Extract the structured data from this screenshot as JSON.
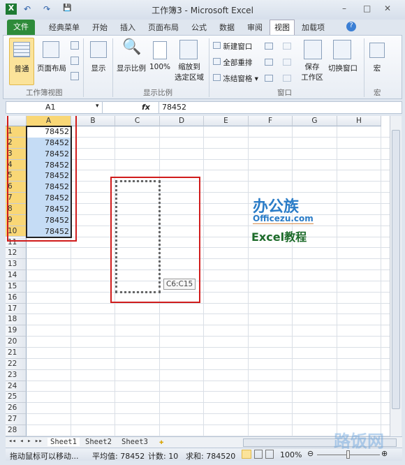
{
  "window": {
    "title": "工作簿3 - Microsoft Excel",
    "minimize": "–",
    "restore": "□",
    "close": "✕"
  },
  "quick_access": {
    "undo": "↶",
    "redo": "↷",
    "save": "💾"
  },
  "tabs": [
    "文件",
    "经典菜单",
    "开始",
    "插入",
    "页面布局",
    "公式",
    "数据",
    "审阅",
    "视图",
    "加载项"
  ],
  "active_tab": "视图",
  "ribbon": {
    "groups": [
      {
        "name": "工作簿视图",
        "buttons": [
          "普通",
          "页面布局"
        ]
      },
      {
        "name": "",
        "buttons": [
          "显示"
        ]
      },
      {
        "name": "显示比例",
        "buttons": [
          "显示比例",
          "100%",
          "缩放到\n选定区域"
        ]
      },
      {
        "name": "窗口",
        "buttons": [
          "新建窗口",
          "全部重排",
          "冻结窗格",
          "保存\n工作区",
          "切换窗口"
        ]
      },
      {
        "name": "宏",
        "buttons": [
          "宏"
        ]
      }
    ]
  },
  "formula_bar": {
    "name_box": "A1",
    "fx": "fx",
    "value": "78452"
  },
  "columns": [
    "A",
    "B",
    "C",
    "D",
    "E",
    "F",
    "G",
    "H"
  ],
  "row_count": 28,
  "cells_A": [
    "78452",
    "78452",
    "78452",
    "78452",
    "78452",
    "78452",
    "78452",
    "78452",
    "78452",
    "78452"
  ],
  "drag_tooltip": "C6:C15",
  "logo": {
    "line1": "办公族",
    "line2": "Officezu.com",
    "line3": "Excel教程"
  },
  "sheets": [
    "Sheet1",
    "Sheet2",
    "Sheet3"
  ],
  "active_sheet": "Sheet1",
  "status": {
    "message": "拖动鼠标可以移动...",
    "average": "平均值: 78452",
    "count": "计数: 10",
    "sum": "求和: 784520",
    "zoom": "100%"
  },
  "watermark": "路饭网",
  "colors": {
    "selection": "#c5dcf5",
    "header_active": "#f9d776",
    "annotation": "#d01c1c",
    "file_tab": "#2e8b3a"
  }
}
